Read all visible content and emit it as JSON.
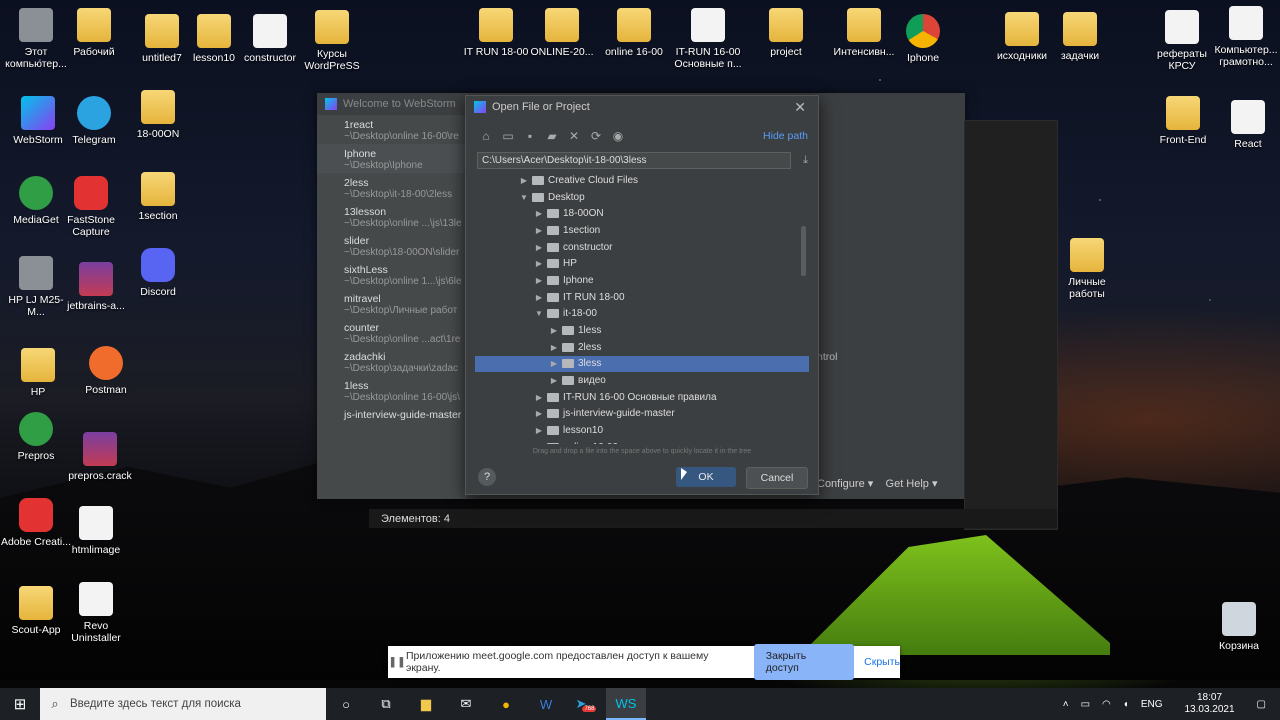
{
  "desktop_icons": [
    "Этот компьютер...",
    "Рабочий",
    "untitled7",
    "lesson10",
    "constructor",
    "Курсы WordPreSS",
    "IT RUN 18-00",
    "ONLINE-20...",
    "online 16-00",
    "IT-RUN 16-00 Основные п...",
    "project",
    "Интенсивн...",
    "Iphone",
    "исходники",
    "задачки",
    "рефераты КРСУ",
    "Компьютер... грамотно...",
    "WebStorm",
    "Telegram",
    "18-00ON",
    "Front-End",
    "React",
    "MediaGet",
    "FastStone Capture",
    "1section",
    "HP LJ M25-M...",
    "jetbrains-a...",
    "Discord",
    "Личные работы",
    "HP",
    "Postman",
    "Prepros",
    "prepros.crack",
    "Adobe Creati...",
    "htmlimage",
    "Scout-App",
    "Revo Uninstaller",
    "Корзина"
  ],
  "welcome": {
    "title": "Welcome to WebStorm",
    "recent": [
      {
        "name": "1react",
        "path": "~\\Desktop\\online 16-00\\re"
      },
      {
        "name": "Iphone",
        "path": "~\\Desktop\\Iphone"
      },
      {
        "name": "2less",
        "path": "~\\Desktop\\it-18-00\\2less"
      },
      {
        "name": "13lesson",
        "path": "~\\Desktop\\online ...\\js\\13le"
      },
      {
        "name": "slider",
        "path": "~\\Desktop\\18-00ON\\slider"
      },
      {
        "name": "sixthLess",
        "path": "~\\Desktop\\online 1...\\js\\6le"
      },
      {
        "name": "mitravel",
        "path": "~\\Desktop\\Личные работ"
      },
      {
        "name": "counter",
        "path": "~\\Desktop\\online ...act\\1re"
      },
      {
        "name": "zadachki",
        "path": "~\\Desktop\\задачки\\zadac"
      },
      {
        "name": "1less",
        "path": "~\\Desktop\\online 16-00\\js\\"
      },
      {
        "name": "js-interview-guide-master",
        "path": ""
      }
    ],
    "big_title_fragment": "m",
    "control_fragment": "ntrol",
    "configure": "Configure ▾",
    "get_help": "Get Help ▾"
  },
  "explorer_status": "Элементов: 4",
  "dialog": {
    "title": "Open File or Project",
    "hide_path": "Hide path",
    "path": "C:\\Users\\Acer\\Desktop\\it-18-00\\3less",
    "tree": [
      {
        "label": "Creative Cloud Files",
        "indent": 3,
        "open": false
      },
      {
        "label": "Desktop",
        "indent": 3,
        "open": true
      },
      {
        "label": "18-00ON",
        "indent": 4,
        "open": false
      },
      {
        "label": "1section",
        "indent": 4,
        "open": false
      },
      {
        "label": "constructor",
        "indent": 4,
        "open": false
      },
      {
        "label": "HP",
        "indent": 4,
        "open": false
      },
      {
        "label": "Iphone",
        "indent": 4,
        "open": false
      },
      {
        "label": "IT RUN 18-00",
        "indent": 4,
        "open": false
      },
      {
        "label": "it-18-00",
        "indent": 4,
        "open": true
      },
      {
        "label": "1less",
        "indent": 5,
        "open": false
      },
      {
        "label": "2less",
        "indent": 5,
        "open": false
      },
      {
        "label": "3less",
        "indent": 5,
        "open": false,
        "selected": true
      },
      {
        "label": "видео",
        "indent": 5,
        "open": false
      },
      {
        "label": "IT-RUN 16-00 Основные правила",
        "indent": 4,
        "open": false
      },
      {
        "label": "js-interview-guide-master",
        "indent": 4,
        "open": false
      },
      {
        "label": "lesson10",
        "indent": 4,
        "open": false
      },
      {
        "label": "online 16-00",
        "indent": 4,
        "open": false
      }
    ],
    "hint": "Drag and drop a file into the space above to quickly locate it in the tree",
    "ok": "OK",
    "cancel": "Cancel",
    "help": "?"
  },
  "share_bar": {
    "text": "Приложению meet.google.com предоставлен доступ к вашему экрану.",
    "grant": "Закрыть доступ",
    "hide": "Скрыть"
  },
  "taskbar": {
    "search_placeholder": "Введите здесь текст для поиска",
    "lang": "ENG",
    "time": "18:07",
    "date": "13.03.2021",
    "telegram_badge": "768"
  }
}
